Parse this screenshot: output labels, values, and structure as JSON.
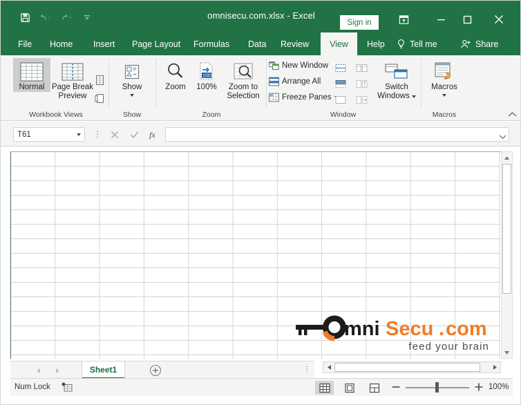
{
  "window": {
    "title": "omnisecu.com.xlsx  -  Excel",
    "signin_label": "Sign in",
    "quick_access": [
      {
        "name": "save-icon",
        "label": "Save"
      },
      {
        "name": "undo-icon",
        "label": "Undo"
      },
      {
        "name": "redo-icon",
        "label": "Redo"
      },
      {
        "name": "customize-quick-access-icon",
        "label": "Customize Quick Access Toolbar"
      }
    ],
    "controls": [
      {
        "name": "ribbon-display-options-icon",
        "label": "Ribbon Display Options"
      },
      {
        "name": "minimize-icon",
        "label": "Minimize"
      },
      {
        "name": "maximize-icon",
        "label": "Maximize"
      },
      {
        "name": "close-icon",
        "label": "Close"
      }
    ]
  },
  "ribbon": {
    "tabs": [
      {
        "label": "File",
        "active": false
      },
      {
        "label": "Home",
        "active": false
      },
      {
        "label": "Insert",
        "active": false
      },
      {
        "label": "Page Layout",
        "active": false
      },
      {
        "label": "Formulas",
        "active": false
      },
      {
        "label": "Data",
        "active": false
      },
      {
        "label": "Review",
        "active": false
      },
      {
        "label": "View",
        "active": true
      },
      {
        "label": "Help",
        "active": false
      }
    ],
    "tell_me": "Tell me",
    "share": "Share",
    "groups": {
      "workbook_views": {
        "label": "Workbook Views",
        "normal": "Normal",
        "page_break_preview_line1": "Page Break",
        "page_break_preview_line2": "Preview",
        "page_layout_icon_label": "Page Layout",
        "custom_views_icon_label": "Custom Views"
      },
      "show": {
        "label": "Show",
        "button": "Show"
      },
      "zoom": {
        "label": "Zoom",
        "zoom": "Zoom",
        "hundred": "100%",
        "zoom_to_selection_line1": "Zoom to",
        "zoom_to_selection_line2": "Selection",
        "badge": "100"
      },
      "window": {
        "label": "Window",
        "new_window": "New Window",
        "arrange_all": "Arrange All",
        "freeze_panes": "Freeze Panes",
        "switch_windows_line1": "Switch",
        "switch_windows_line2": "Windows",
        "split_icon_label": "Split",
        "hide_icon_label": "Hide",
        "unhide_icon_label": "Unhide",
        "view_side_by_side_label": "View Side by Side",
        "synchronous_scrolling_label": "Synchronous Scrolling",
        "reset_window_position_label": "Reset Window Position"
      },
      "macros": {
        "label": "Macros",
        "button": "Macros"
      }
    },
    "collapse_label": "Collapse the Ribbon"
  },
  "formula_bar": {
    "name_box_value": "T61",
    "cancel_label": "Cancel",
    "enter_label": "Enter",
    "insert_function_label": "Insert Function",
    "formula_value": "",
    "expand_label": "Expand Formula Bar"
  },
  "sheet": {
    "columns": 11,
    "rows": 14,
    "watermark": {
      "brand_omni": "Omni",
      "brand_secu": "Secu",
      "brand_dot": ".",
      "brand_com": "com",
      "tagline": "feed your brain",
      "key_icon_label": "key-logo"
    }
  },
  "sheet_tabs": {
    "prev_label": "Previous Sheet",
    "next_label": "Next Sheet",
    "tabs": [
      {
        "label": "Sheet1",
        "active": true
      }
    ],
    "add_label": "New sheet"
  },
  "status_bar": {
    "status_text": "Num Lock",
    "recording_macro_label": "Record Macro",
    "views": [
      {
        "name": "normal-view-button",
        "label": "Normal",
        "active": true
      },
      {
        "name": "page-layout-view-button",
        "label": "Page Layout",
        "active": false
      },
      {
        "name": "page-break-preview-view-button",
        "label": "Page Break Preview",
        "active": false
      }
    ],
    "zoom_out_label": "Zoom Out",
    "zoom_in_label": "Zoom In",
    "zoom_value": "100%"
  },
  "colors": {
    "brand_green": "#217346",
    "ribbon_bg": "#f4f5f3",
    "accent_orange": "#f07d28",
    "grid_line": "#d4d4d4"
  }
}
